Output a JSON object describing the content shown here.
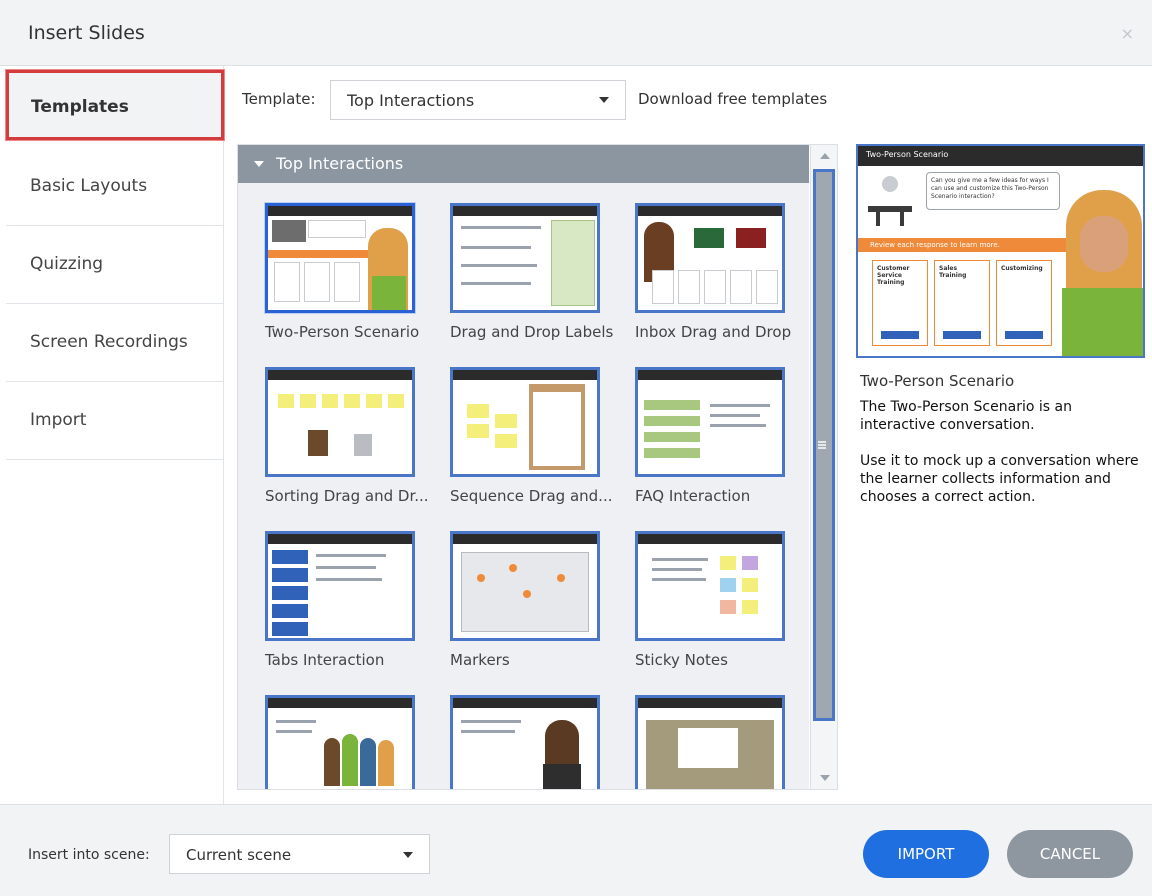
{
  "window": {
    "title": "Insert Slides",
    "close_glyph": "×"
  },
  "sidebar": {
    "items": [
      {
        "label": "Templates",
        "active": true
      },
      {
        "label": "Basic Layouts"
      },
      {
        "label": "Quizzing"
      },
      {
        "label": "Screen Recordings"
      },
      {
        "label": "Import"
      }
    ]
  },
  "template_bar": {
    "label": "Template:",
    "selected": "Top Interactions",
    "download_link": "Download free templates"
  },
  "gallery": {
    "group_title": "Top Interactions",
    "tiles": [
      {
        "label": "Two-Person Scenario",
        "selected": true
      },
      {
        "label": "Drag and Drop Labels"
      },
      {
        "label": "Inbox Drag and Drop"
      },
      {
        "label": "Sorting Drag and Dr..."
      },
      {
        "label": "Sequence Drag and..."
      },
      {
        "label": "FAQ Interaction"
      },
      {
        "label": "Tabs Interaction"
      },
      {
        "label": "Markers"
      },
      {
        "label": "Sticky Notes"
      },
      {
        "label": ""
      },
      {
        "label": ""
      },
      {
        "label": ""
      }
    ]
  },
  "preview": {
    "header": "Two-Person Scenario",
    "banner": "Review each response to learn more.",
    "bubble": "Can you give me a few ideas for ways I can use and customize this Two-Person Scenario interaction?",
    "cards": [
      "Customer Service Training",
      "Sales Training",
      "Customizing"
    ],
    "name": "Two-Person Scenario",
    "description_1": "The Two-Person Scenario is an interactive conversation.",
    "description_2": "Use it to mock up a conversation where the learner collects information and chooses a correct action."
  },
  "footer": {
    "scene_label": "Insert into scene:",
    "scene_value": "Current scene",
    "import_label": "IMPORT",
    "cancel_label": "CANCEL"
  },
  "colors": {
    "accent_blue": "#1f6fe0",
    "selection_red": "#d23c3c",
    "group_header": "#8b96a1",
    "cancel_gray": "#8e979f"
  }
}
